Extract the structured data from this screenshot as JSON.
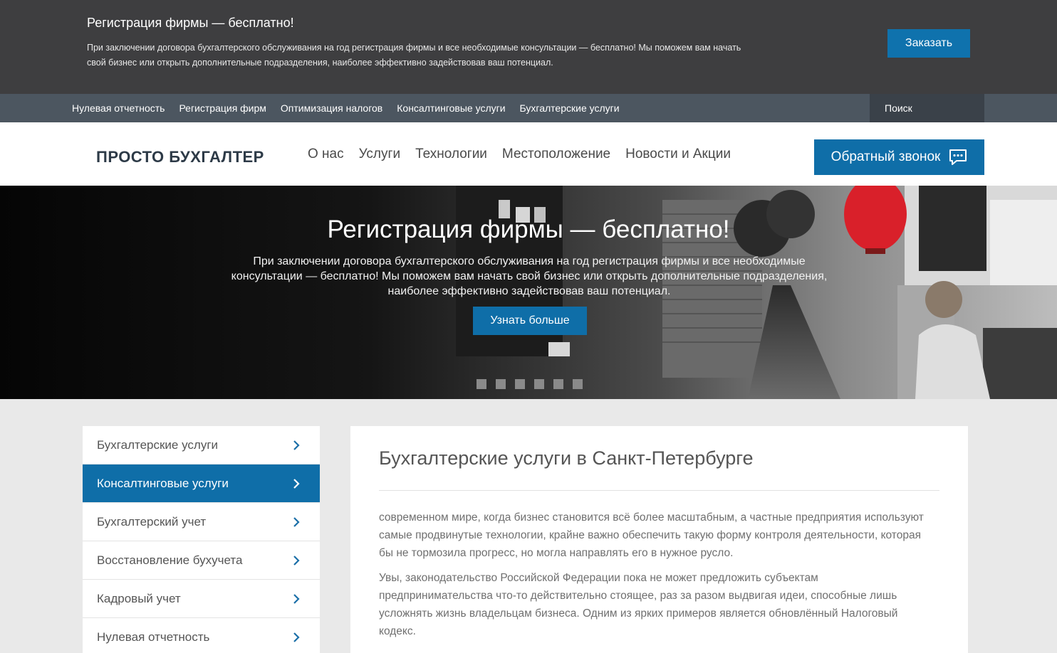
{
  "promo": {
    "title": "Регистрация фирмы — бесплатно!",
    "text": "При заключении договора бухгалтерского обслуживания на год регистрация фирмы и все необходимые консультации — бесплатно! Мы поможем вам начать свой бизнес или открыть дополнительные подразделения, наиболее эффективно задействовав ваш потенциал.",
    "button": "Заказать"
  },
  "service_nav": {
    "items": [
      "Нулевая отчетность",
      "Регистрация фирм",
      "Оптимизация налогов",
      "Консалтинговые услуги",
      "Бухгалтерские услуги"
    ],
    "search_placeholder": "Поиск"
  },
  "header": {
    "logo": "ПРОСТО БУХГАЛТЕР",
    "nav": [
      "О нас",
      "Услуги",
      "Технологии",
      "Местоположение",
      "Новости и Акции"
    ],
    "callback": "Обратный звонок"
  },
  "hero": {
    "title": "Регистрация фирмы — бесплатно!",
    "text": "При заключении договора бухгалтерского обслуживания на год регистрация фирмы и все необходимые консультации — бесплатно! Мы поможем вам начать свой бизнес или открыть дополнительные подразделения, наиболее эффективно задействовав ваш потенциал.",
    "button": "Узнать больше",
    "slide_count": 6
  },
  "sidebar": {
    "items": [
      "Бухгалтерские услуги",
      "Консалтинговые услуги",
      "Бухгалтерский учет",
      "Восстановление бухучета",
      "Кадровый учет",
      "Нулевая отчетность"
    ],
    "active_index": 1
  },
  "content": {
    "title": "Бухгалтерские услуги в Санкт-Петербурге",
    "paragraphs": [
      "современном мире, когда бизнес становится всё более масштабным, а частные предприятия используют самые продвинутые технологии, крайне важно обеспечить такую форму контроля деятельности, которая бы не тормозила прогресс, но могла направлять его в нужное русло.",
      "Увы, законодательство Российской Федерации пока не может предложить субъектам предпринимательства что-то действительно стоящее, раз за разом выдвигая идеи, способные лишь усложнять жизнь владельцам бизнеса. Одним из ярких примеров является обновлённый Налоговый кодекс."
    ]
  },
  "colors": {
    "promo_bg": "#3e3e40",
    "service_nav_bg": "#4c5660",
    "accent": "#0f6ea8",
    "page_bg": "#e9e9e9"
  }
}
